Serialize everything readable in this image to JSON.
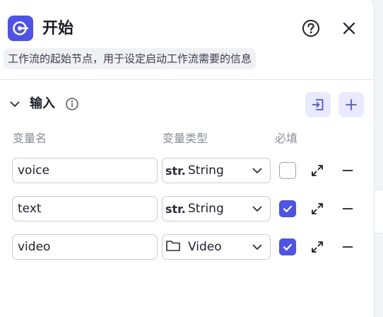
{
  "node": {
    "title": "开始",
    "description": "工作流的起始节点，用于设定启动工作流需要的信息",
    "icon": "play-node-icon",
    "accent": "#4d53e8"
  },
  "inputs_section": {
    "title": "输入",
    "columns": {
      "name": "变量名",
      "type": "变量类型",
      "required": "必填"
    },
    "rows": [
      {
        "name": "voice",
        "type_icon": "str.",
        "type": "String",
        "required": false
      },
      {
        "name": "text",
        "type_icon": "str.",
        "type": "String",
        "required": true
      },
      {
        "name": "video",
        "type_icon": "folder-icon",
        "type": "Video",
        "required": true
      }
    ]
  }
}
